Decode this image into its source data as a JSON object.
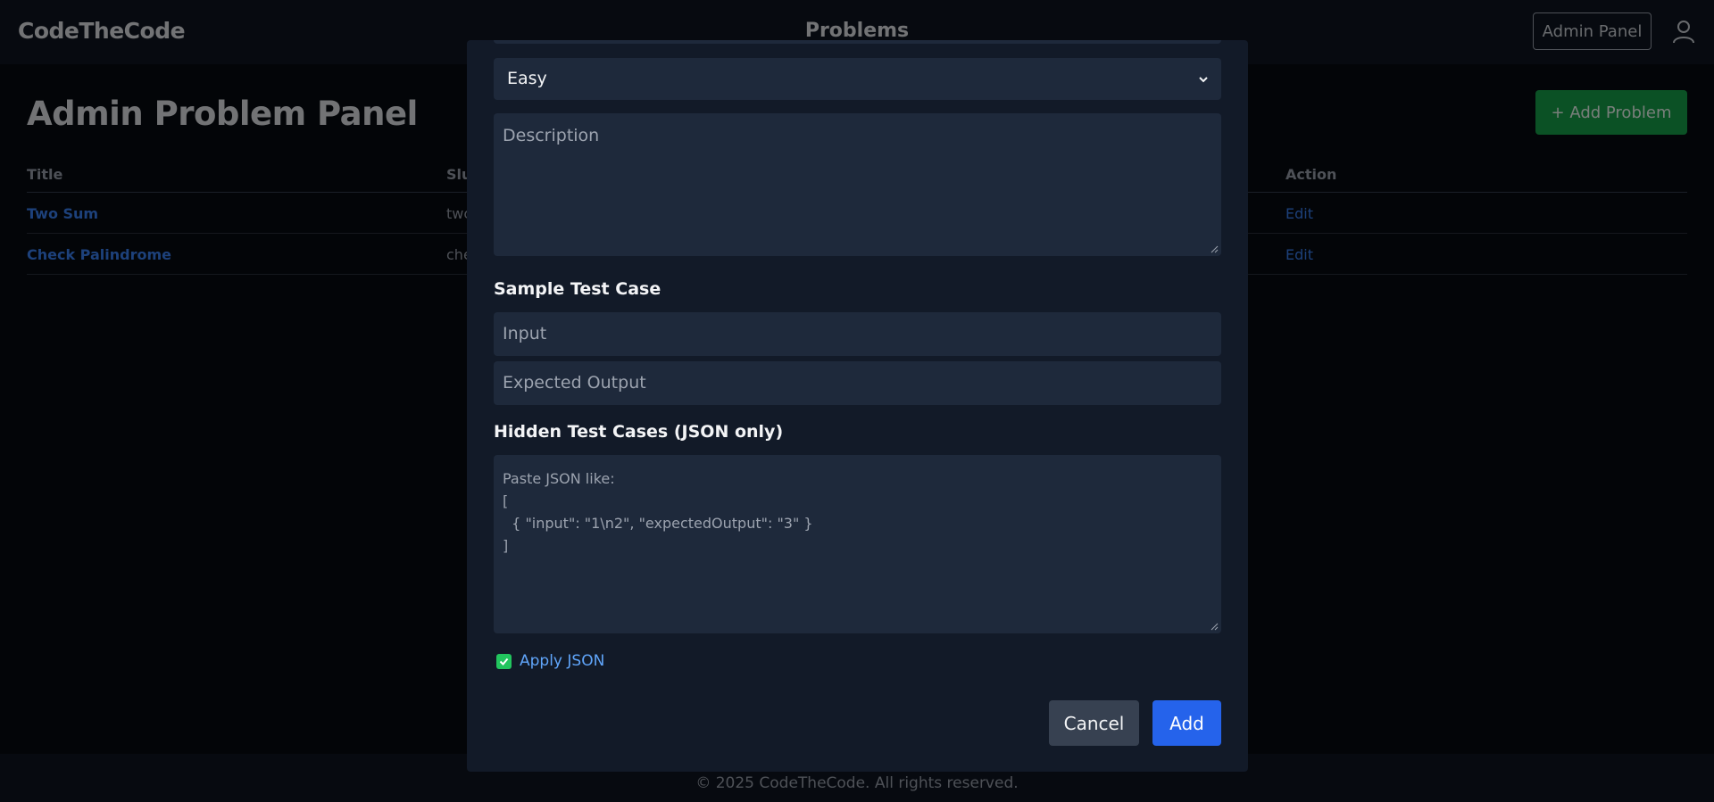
{
  "navbar": {
    "brand": "CodeTheCode",
    "center_title": "Problems",
    "admin_button": "Admin Panel",
    "user_icon": "user-icon"
  },
  "page": {
    "title": "Admin Problem Panel",
    "add_button": "+ Add Problem",
    "table": {
      "headers": [
        "Title",
        "Slu",
        "Action"
      ],
      "rows": [
        {
          "title": "Two Sum",
          "slug": "twc",
          "action": "Edit"
        },
        {
          "title": "Check Palindrome",
          "slug": "che",
          "action": "Edit"
        }
      ]
    }
  },
  "footer": {
    "text": "© 2025 CodeTheCode. All rights reserved."
  },
  "modal": {
    "difficulty": {
      "value": "Easy",
      "icon": "chevron-down-icon"
    },
    "description": {
      "placeholder": "Description"
    },
    "sample_section": {
      "label": "Sample Test Case",
      "input_placeholder": "Input",
      "output_placeholder": "Expected Output"
    },
    "hidden_section": {
      "label": "Hidden Test Cases (JSON only)",
      "placeholder_lines": [
        "Paste JSON like:",
        "[",
        "  { \"input\": \"1\\n2\", \"expectedOutput\": \"3\" }",
        "]"
      ]
    },
    "apply_json": {
      "label": "Apply JSON",
      "checked": true,
      "icon": "check-icon"
    },
    "buttons": {
      "cancel": "Cancel",
      "add": "Add"
    }
  },
  "colors": {
    "accent": "#2563eb",
    "success": "#16a34a",
    "link": "#3b82f6"
  }
}
